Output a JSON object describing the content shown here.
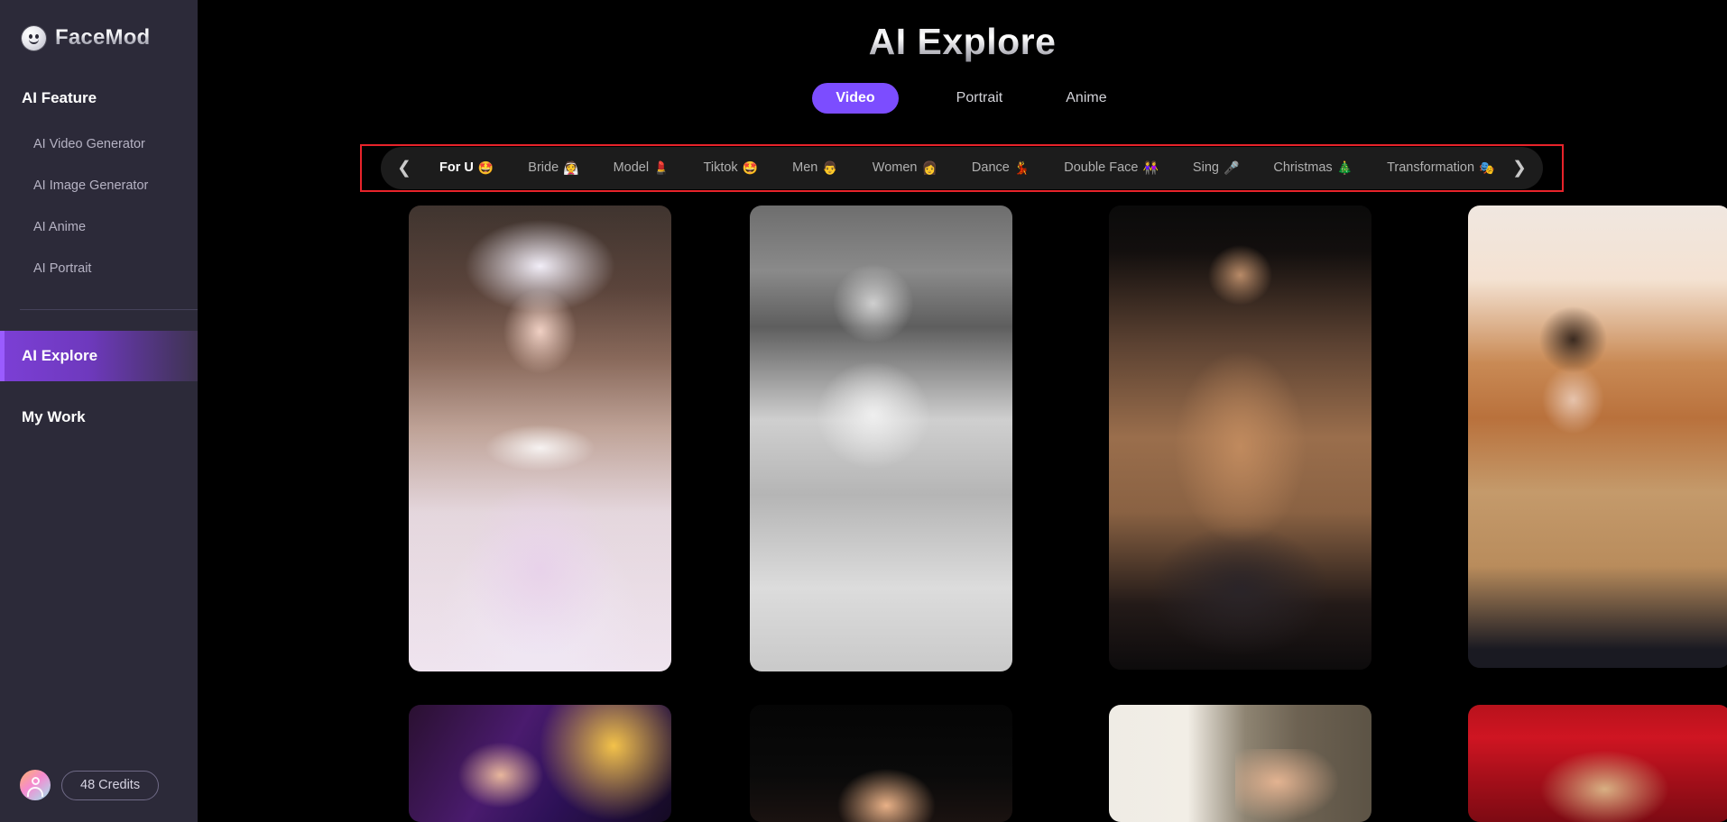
{
  "brand": {
    "name": "FaceMod",
    "logo_icon": "face-circle-icon"
  },
  "sidebar": {
    "section_title": "AI Feature",
    "feature_items": [
      {
        "label": "AI Video Generator"
      },
      {
        "label": "AI Image Generator"
      },
      {
        "label": "AI Anime"
      },
      {
        "label": "AI Portrait"
      }
    ],
    "main_items": [
      {
        "label": "AI Explore",
        "active": true
      },
      {
        "label": "My Work",
        "active": false
      }
    ],
    "footer": {
      "avatar_icon": "user-avatar-icon",
      "credits_label": "48 Credits"
    }
  },
  "header": {
    "title": "AI Explore",
    "tabs": [
      {
        "label": "Video",
        "active": true
      },
      {
        "label": "Portrait",
        "active": false
      },
      {
        "label": "Anime",
        "active": false
      }
    ]
  },
  "categories": {
    "prev_icon": "chevron-left-icon",
    "next_icon": "chevron-right-icon",
    "items": [
      {
        "label": "For U",
        "emoji": "🤩",
        "active": true
      },
      {
        "label": "Bride",
        "emoji": "👰",
        "active": false
      },
      {
        "label": "Model",
        "emoji": "💄",
        "active": false
      },
      {
        "label": "Tiktok",
        "emoji": "🤩",
        "active": false
      },
      {
        "label": "Men",
        "emoji": "👨",
        "active": false
      },
      {
        "label": "Women",
        "emoji": "👩",
        "active": false
      },
      {
        "label": "Dance",
        "emoji": "💃",
        "active": false
      },
      {
        "label": "Double Face",
        "emoji": "👭",
        "active": false
      },
      {
        "label": "Sing",
        "emoji": "🎤",
        "active": false
      },
      {
        "label": "Christmas",
        "emoji": "🎄",
        "active": false
      },
      {
        "label": "Transformation",
        "emoji": "🎭",
        "active": false
      }
    ]
  },
  "gallery": {
    "row1": [
      {
        "alt": "bride-in-white-gown-with-crown"
      },
      {
        "alt": "black-and-white-vintage-young-man"
      },
      {
        "alt": "shirtless-muscular-man"
      },
      {
        "alt": "young-man-in-tan-jacket-at-bar"
      }
    ],
    "row2": [
      {
        "alt": "woman-with-long-hair-purple-stage"
      },
      {
        "alt": "blonde-woman-dark-background"
      },
      {
        "alt": "brunette-woman-beige-column"
      },
      {
        "alt": "blonde-woman-red-background"
      }
    ]
  },
  "annotation": {
    "color": "#e8232a",
    "target": "category-filter-bar"
  }
}
